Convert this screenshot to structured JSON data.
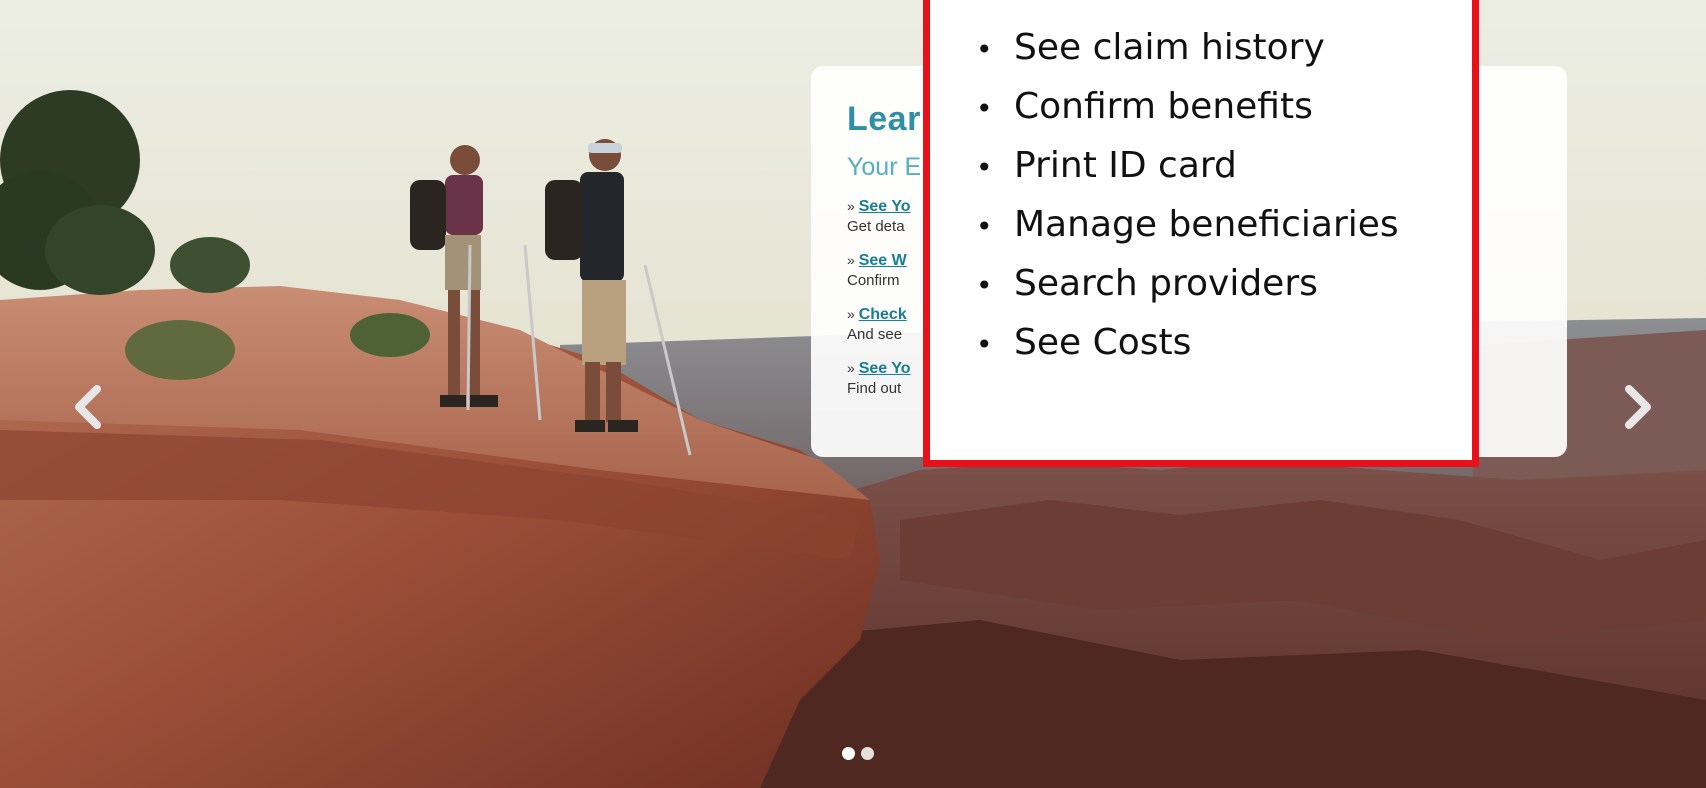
{
  "hero": {
    "prev_arrow_icon": "chevron-left-icon",
    "next_arrow_icon": "chevron-right-icon",
    "dots": [
      {
        "active": true
      },
      {
        "active": false
      }
    ]
  },
  "panel": {
    "heading": "Lear",
    "subheading": "Your E",
    "links": [
      {
        "prefix": "» ",
        "label": "See Yo",
        "desc": "Get deta"
      },
      {
        "prefix": "» ",
        "label": "See W",
        "desc": "Confirm"
      },
      {
        "prefix": "» ",
        "label": "Check",
        "desc": "And see"
      },
      {
        "prefix": "» ",
        "label": "See Yo",
        "desc": "Find out"
      }
    ]
  },
  "callout": {
    "bullet_char": "•",
    "items": [
      "See claim history",
      "Confirm benefits",
      "Print ID card",
      "Manage beneficiaries",
      "Search providers",
      "See Costs"
    ],
    "border_color": "#e8101a"
  },
  "colors": {
    "heading": "#2f8fa6",
    "link": "#1a7d97",
    "callout_border": "#e8101a"
  }
}
